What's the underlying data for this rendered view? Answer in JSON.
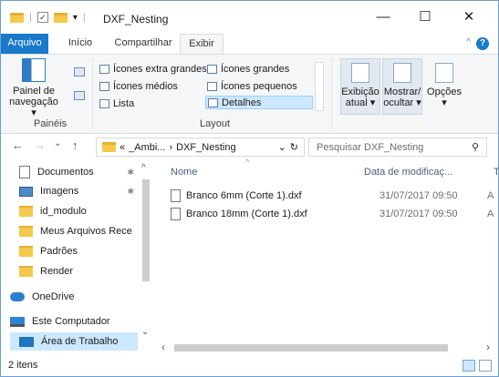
{
  "window": {
    "title": "DXF_Nesting",
    "controls": {
      "minimize": "—",
      "maximize": "☐",
      "close": "✕"
    }
  },
  "quick_access": {
    "separator": "|",
    "dropdown": "▾",
    "check": "✓"
  },
  "ribbon": {
    "tabs": [
      {
        "label": "Arquivo"
      },
      {
        "label": "Início"
      },
      {
        "label": "Compartilhar"
      },
      {
        "label": "Exibir"
      }
    ],
    "collapse_glyph": "^",
    "help_glyph": "?",
    "paineis": {
      "group_label": "Painéis",
      "nav_pane_line1": "Painel de",
      "nav_pane_line2": "navegação ▾"
    },
    "layout": {
      "group_label": "Layout",
      "items": [
        "Ícones extra grandes",
        "Ícones grandes",
        "Ícones médios",
        "Ícones pequenos",
        "Lista",
        "Detalhes"
      ],
      "selected": "Detalhes"
    },
    "view_buttons": [
      {
        "line1": "Exibição",
        "line2": "atual ▾"
      },
      {
        "line1": "Mostrar/",
        "line2": "ocultar ▾"
      },
      {
        "line1": "Opções",
        "line2": "▾"
      }
    ]
  },
  "address": {
    "back": "←",
    "forward": "→",
    "recent": "⌄",
    "up": "↑",
    "crumbs": [
      "«",
      "_Ambi...",
      "›",
      "DXF_Nesting"
    ],
    "dropdown": "⌄",
    "refresh": "↻",
    "search_placeholder": "Pesquisar DXF_Nesting",
    "search_icon": "⚲"
  },
  "nav_pane": {
    "items": [
      {
        "label": "Documentos",
        "icon": "document-icon",
        "pinned": true
      },
      {
        "label": "Imagens",
        "icon": "pictures-icon",
        "pinned": true
      },
      {
        "label": "id_modulo",
        "icon": "folder-icon",
        "pinned": false
      },
      {
        "label": "Meus Arquivos Rece",
        "icon": "folder-icon",
        "pinned": false
      },
      {
        "label": "Padrões",
        "icon": "folder-icon",
        "pinned": false
      },
      {
        "label": "Render",
        "icon": "folder-icon",
        "pinned": false
      },
      {
        "label": "OneDrive",
        "icon": "onedrive-icon",
        "pinned": false
      },
      {
        "label": "Este Computador",
        "icon": "computer-icon",
        "pinned": false
      },
      {
        "label": "Área de Trabalho",
        "icon": "desktop-icon",
        "pinned": false,
        "selected": true
      }
    ],
    "pin_glyph": "✱"
  },
  "files": {
    "columns": [
      "Nome",
      "Data de modificaç...",
      "T"
    ],
    "rows": [
      {
        "name": "Branco 6mm (Corte 1).dxf",
        "modified": "31/07/2017 09:50",
        "type_initial": "A"
      },
      {
        "name": "Branco 18mm (Corte 1).dxf",
        "modified": "31/07/2017 09:50",
        "type_initial": "A"
      }
    ]
  },
  "status": {
    "item_count": "2 itens"
  },
  "scroll_glyphs": {
    "up": "^",
    "down": "⌄",
    "left": "‹",
    "right": "›"
  }
}
